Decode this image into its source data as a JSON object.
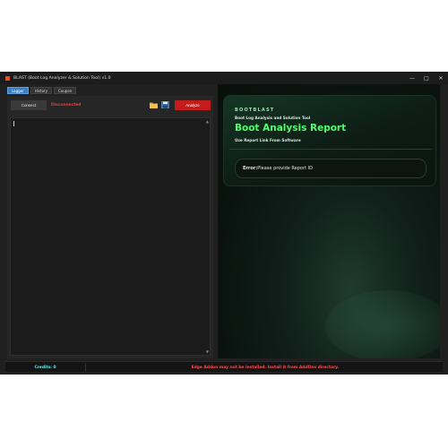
{
  "window": {
    "title": "BLAST (Boot Log Analyzer & Solution Tool) v1.0",
    "controls": [
      "—",
      "□",
      "✕"
    ]
  },
  "tabs": [
    {
      "label": "Logger",
      "active": true
    },
    {
      "label": "History",
      "active": false
    },
    {
      "label": "Coupon",
      "active": false
    }
  ],
  "toolbar": {
    "connect_label": "Connect",
    "status": "Disconnected",
    "status_color": "#ff3333",
    "open_icon": "folder-icon",
    "save_icon": "save-icon",
    "analyze_label": "Analyze",
    "analyze_color": "#c41b1b"
  },
  "report": {
    "brand": "BOOTBLAST",
    "subtitle": "Boot Log Analysis and Solution Tool",
    "title": "Boot Analysis Report",
    "link_text": "Use Report Link From Software",
    "error_label": "Error:",
    "error_message": "Please provide Report ID",
    "title_color": "#4dff6a"
  },
  "statusbar": {
    "credits": "Credits: 0",
    "credits_color": "#61e8e8",
    "warning": "Edge Addon may not be installed. Install it from AddOns directory.",
    "warning_color": "#ff4a4a"
  }
}
